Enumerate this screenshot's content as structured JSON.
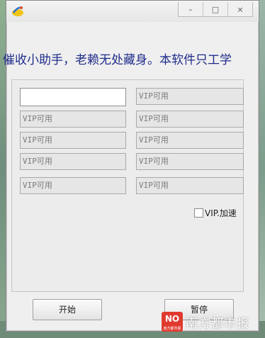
{
  "window": {
    "controls": [
      "–",
      "□",
      "×"
    ],
    "marquee_text": "催收小助手，老赖无处藏身。本软件只工学"
  },
  "fields": {
    "left": [
      "",
      "VIP可用",
      "VIP可用",
      "VIP可用",
      "VIP可用"
    ],
    "right": [
      "VIP可用",
      "VIP可用",
      "VIP可用",
      "VIP可用",
      "VIP可用"
    ]
  },
  "options": {
    "vip_speed_label": "VIP.加速",
    "vip_speed_checked": false
  },
  "buttons": {
    "start_label": "开始",
    "pause_label": "暂停"
  },
  "watermark": {
    "logo_text": "NO",
    "logo_caption": "南方都市报",
    "text": "南方都市报"
  },
  "colors": {
    "marquee": "#1f2c8a",
    "watermark_logo": "#e03a2f"
  }
}
